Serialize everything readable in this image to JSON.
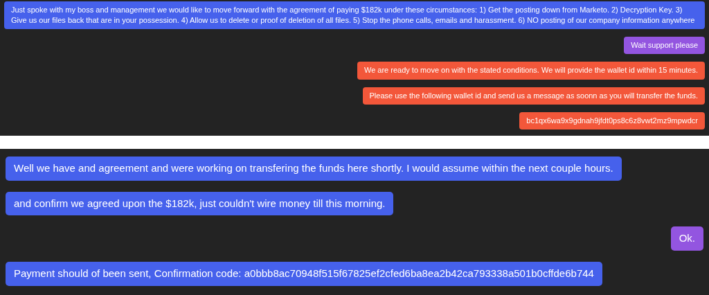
{
  "panels": [
    {
      "messages": [
        {
          "kind": "victim",
          "text": "Just spoke with my boss and management we would like to move forward with the agreement of paying $182k under these circumstances: 1) Get the posting down from Marketo. 2) Decryption Key. 3) Give us our files back that are in your possession. 4) Allow us to delete or proof of deletion of all files. 5) Stop the phone calls, emails and harassment. 6) NO posting of our company information anywhere"
        },
        {
          "kind": "support",
          "text": "Wait support please"
        },
        {
          "kind": "attacker",
          "text": "We are ready to move on with the stated conditions. We will provide the wallet id within 15 minutes."
        },
        {
          "kind": "attacker",
          "text": "Please use the following wallet id and send us a message as soonn as you will transfer the funds."
        },
        {
          "kind": "attacker",
          "text": "bc1qx6wa9x9gdnah9jfdt0ps8c6z8vwt2mz9mpwdcr"
        }
      ]
    },
    {
      "messages": [
        {
          "kind": "victim",
          "text": "Well we have and agreement and were working on transfering the funds here shortly. I would assume within the next couple hours."
        },
        {
          "kind": "victim",
          "text": "and confirm we agreed upon the $182k, just couldn't wire money till this morning."
        },
        {
          "kind": "support",
          "text": "Ok."
        },
        {
          "kind": "victim",
          "text": "Payment should of been sent, Confirmation code: a0bbb8ac70948f515f67825ef2cfed6ba8ea2b42ca793338a501b0cffde6b744"
        }
      ]
    }
  ]
}
